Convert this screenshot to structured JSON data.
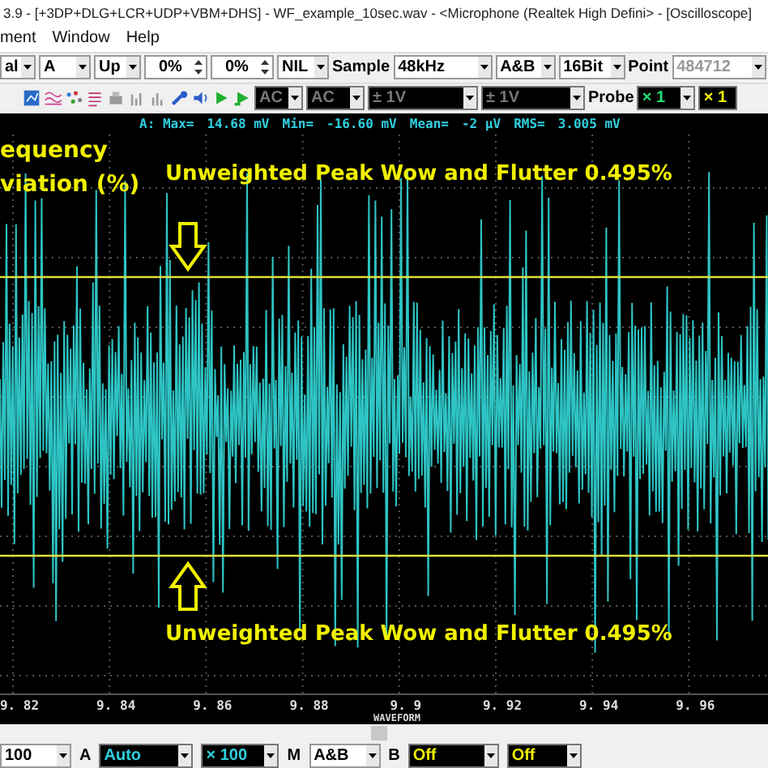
{
  "window": {
    "title": "3.9  -  [+3DP+DLG+LCR+UDP+VBM+DHS]  -  WF_example_10sec.wav  -  <Microphone (Realtek High Defini>  - [Oscilloscope]"
  },
  "menu": [
    "ment",
    "Window",
    "Help"
  ],
  "toolbar_1": [
    {
      "kind": "combo",
      "value": "al",
      "disabled": false
    },
    {
      "kind": "combo",
      "value": "A",
      "disabled": false
    },
    {
      "kind": "combo",
      "value": "Up",
      "disabled": false
    },
    {
      "kind": "spin",
      "value": "0%"
    },
    {
      "kind": "spin",
      "value": "0%"
    },
    {
      "kind": "combo",
      "value": "NIL",
      "disabled": false
    },
    {
      "kind": "label",
      "text": "Sample"
    },
    {
      "kind": "combo",
      "value": "48kHz",
      "disabled": false
    },
    {
      "kind": "combo",
      "value": "A&B",
      "disabled": false
    },
    {
      "kind": "combo",
      "value": "16Bit",
      "disabled": false
    },
    {
      "kind": "label",
      "text": "Point"
    },
    {
      "kind": "combo",
      "value": "484712",
      "disabled": true
    }
  ],
  "toolbar_2": [
    {
      "kind": "combo",
      "value": "AC",
      "disabled": true
    },
    {
      "kind": "combo",
      "value": "AC",
      "disabled": true
    },
    {
      "kind": "combo",
      "value": "± 1V",
      "disabled": true
    },
    {
      "kind": "combo",
      "value": "± 1V",
      "disabled": true
    },
    {
      "kind": "label",
      "text": "Probe"
    },
    {
      "kind": "combo",
      "value": "× 1",
      "color": "#20e070"
    },
    {
      "kind": "combo",
      "value": "× 1",
      "color": "#f0f000"
    }
  ],
  "stats": [
    "A: Max=",
    "14.68 mV",
    "Min=",
    "-16.60 mV",
    "Mean=",
    "-2 μV",
    "RMS=",
    "3.005 mV"
  ],
  "plot": {
    "labels": [
      "equency",
      "viation (%)"
    ],
    "annotations": [
      "Unweighted Peak Wow and Flutter 0.495%",
      "Unweighted Peak Wow and Flutter 0.495%"
    ],
    "x_ticks": [
      "9. 82",
      "9. 84",
      "9. 86",
      "9. 88",
      "9. 9",
      "9. 92",
      "9. 94",
      "9. 96"
    ],
    "axis_title": "WAVEFORM"
  },
  "bottom_toolbar": [
    {
      "kind": "combo",
      "value": "100"
    },
    {
      "kind": "label",
      "text": "A"
    },
    {
      "kind": "combo",
      "value": "Auto",
      "color": "#30d0e0"
    },
    {
      "kind": "combo",
      "value": "× 100",
      "color": "#30d0e0"
    },
    {
      "kind": "label",
      "text": "M"
    },
    {
      "kind": "combo",
      "value": "A&B"
    },
    {
      "kind": "label",
      "text": "B"
    },
    {
      "kind": "combo",
      "value": "Off",
      "color": "#f0f000"
    },
    {
      "kind": "combo",
      "value": "Off",
      "color": "#f0f000"
    }
  ]
}
